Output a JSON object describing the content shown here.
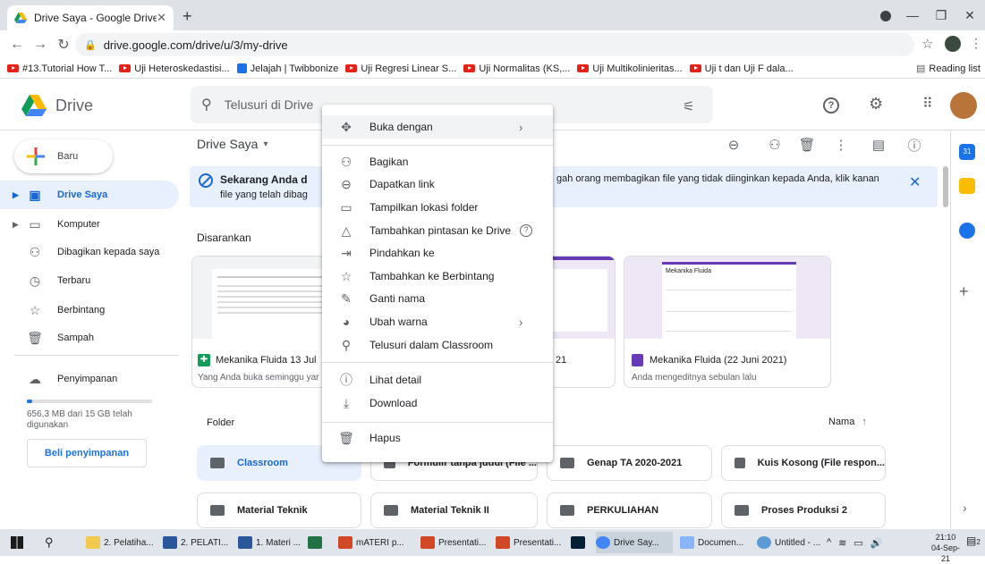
{
  "browser": {
    "tab_title": "Drive Saya - Google Drive",
    "url": "drive.google.com/drive/u/3/my-drive",
    "bookmarks": [
      "#13.Tutorial How T...",
      "Uji Heteroskedastisi...",
      "Jelajah | Twibbonize",
      "Uji Regresi Linear S...",
      "Uji Normalitas (KS,...",
      "Uji Multikolinieritas...",
      "Uji t dan Uji F dala..."
    ],
    "reading_list": "Reading list"
  },
  "drive": {
    "app_name": "Drive",
    "search_placeholder": "Telusuri di Drive",
    "new_button": "Baru",
    "sidebar": [
      "Drive Saya",
      "Komputer",
      "Dibagikan kepada saya",
      "Terbaru",
      "Berbintang",
      "Sampah",
      "Penyimpanan"
    ],
    "storage_text": "656,3 MB dari 15 GB telah digunakan",
    "storage_fraction": 0.044,
    "buy_storage": "Beli penyimpanan",
    "breadcrumb": "Drive Saya",
    "banner_text_1": "Sekarang Anda d",
    "banner_text_1b": "gah orang membagikan file yang tidak diinginkan kepada Anda, klik kanan",
    "banner_text_2": "file yang telah dibag",
    "suggested_label": "Disarankan",
    "cards": [
      {
        "title": "Mekanika Fluida 13 Jul",
        "sub": "Yang Anda buka seminggu yar"
      },
      {
        "title": "21",
        "sub": ""
      },
      {
        "title": "Mekanika Fluida (22 Juni 2021)",
        "sub": "Anda mengeditnya sebulan lalu"
      }
    ],
    "card3_preview_title": "Mekanika Fluida",
    "folder_label": "Folder",
    "sort_label": "Nama",
    "folders": [
      "Classroom",
      "Formulir tanpa judul (File ...",
      "Genap TA 2020-2021",
      "Kuis Kosong (File respon...",
      "Material Teknik",
      "Material Teknik II",
      "PERKULIAHAN",
      "Proses Produksi 2"
    ]
  },
  "context_menu": [
    "Buka dengan",
    "Bagikan",
    "Dapatkan link",
    "Tampilkan lokasi folder",
    "Tambahkan pintasan ke Drive",
    "Pindahkan ke",
    "Tambahkan ke Berbintang",
    "Ganti nama",
    "Ubah warna",
    "Telusuri dalam Classroom",
    "Lihat detail",
    "Download",
    "Hapus"
  ],
  "taskbar": {
    "items": [
      "2. Pelatiha...",
      "2. PELATI...",
      "1. Materi ...",
      "mATERI p...",
      "Presentati...",
      "Presentati...",
      "Drive Say...",
      "Documen...",
      "Untitled - ..."
    ],
    "time": "21:10",
    "date": "04-Sep-21",
    "notif_count": "2"
  },
  "colors": {
    "accent": "#1967d2",
    "banner": "#e8f0fe",
    "tab_strip": "#dee1e6"
  }
}
